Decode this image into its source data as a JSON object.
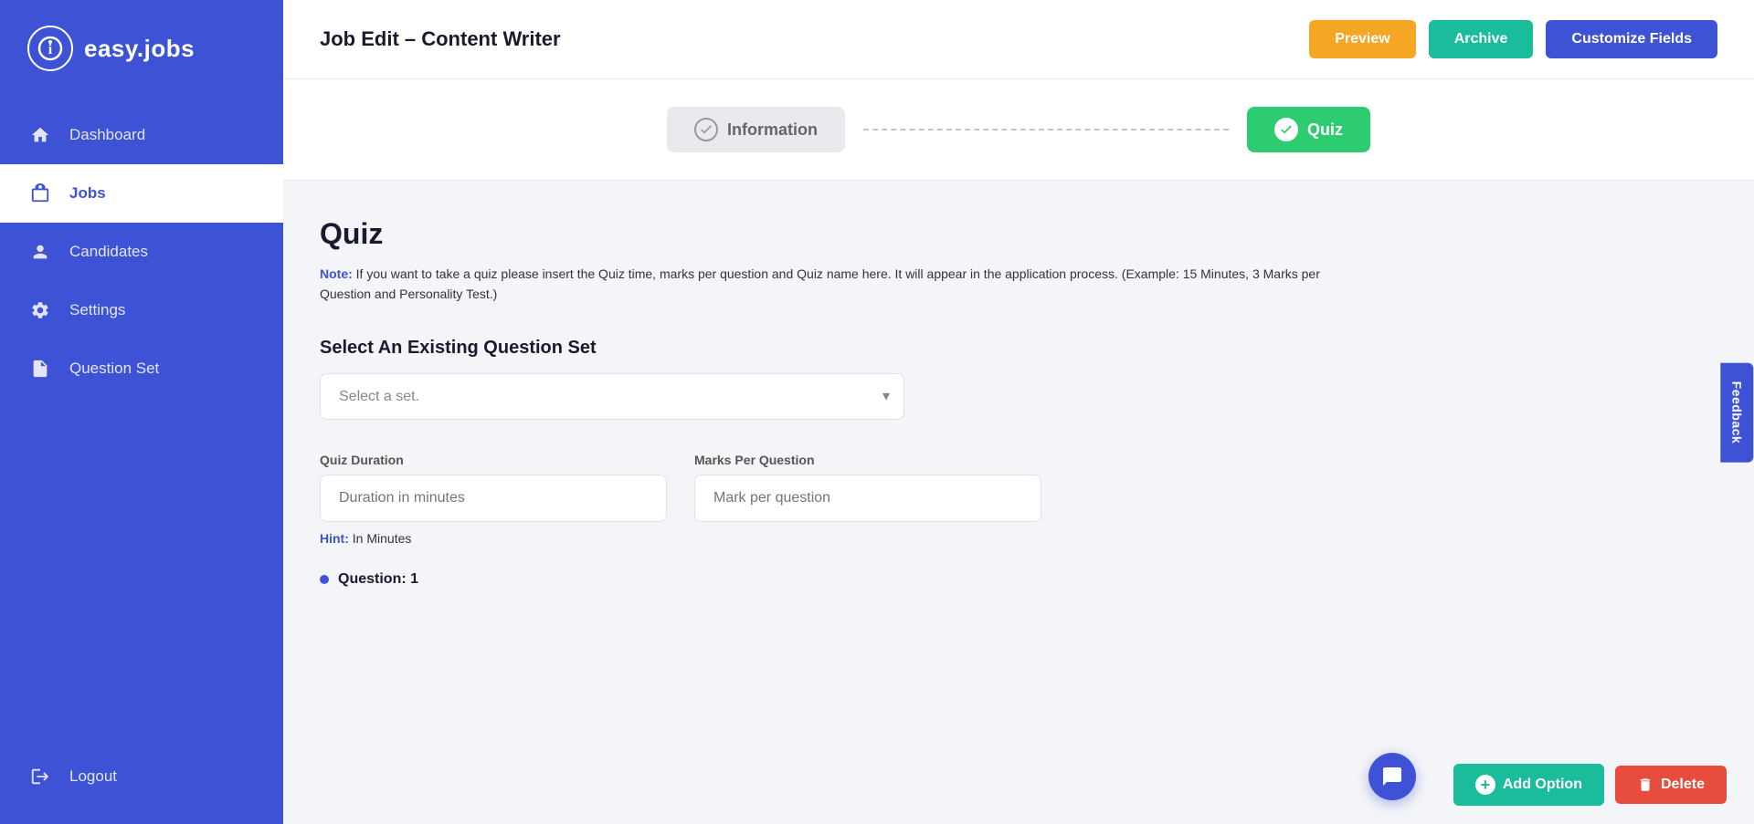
{
  "sidebar": {
    "logo": {
      "icon": "i",
      "text": "easy.jobs"
    },
    "items": [
      {
        "id": "dashboard",
        "label": "Dashboard",
        "icon": "⌂",
        "active": false
      },
      {
        "id": "jobs",
        "label": "Jobs",
        "icon": "💼",
        "active": true
      },
      {
        "id": "candidates",
        "label": "Candidates",
        "icon": "👤",
        "active": false
      },
      {
        "id": "settings",
        "label": "Settings",
        "icon": "⚙",
        "active": false
      },
      {
        "id": "question-set",
        "label": "Question Set",
        "icon": "📄",
        "active": false
      }
    ],
    "logout": {
      "label": "Logout",
      "icon": "→"
    }
  },
  "header": {
    "title": "Job Edit – Content Writer",
    "buttons": {
      "preview": "Preview",
      "archive": "Archive",
      "customize": "Customize Fields"
    }
  },
  "steps": [
    {
      "id": "information",
      "label": "Information",
      "active": false
    },
    {
      "id": "quiz",
      "label": "Quiz",
      "active": true
    }
  ],
  "quiz": {
    "title": "Quiz",
    "note_label": "Note:",
    "note_text": " If you want to take a quiz please insert the Quiz time, marks per question and Quiz name here. It will appear in the application process. (Example: 15 Minutes, 3 Marks per Question and Personality Test.)",
    "section_label": "Select An Existing Question Set",
    "select_placeholder": "Select a set.",
    "duration_label": "Quiz Duration",
    "duration_placeholder": "Duration in minutes",
    "marks_label": "Marks Per Question",
    "marks_placeholder": "Mark per question",
    "hint_label": "Hint:",
    "hint_text": " In Minutes",
    "question_label": "Question: 1"
  },
  "bottom": {
    "add_option": "Add Option",
    "delete": "Delete"
  },
  "feedback": "Feedback"
}
